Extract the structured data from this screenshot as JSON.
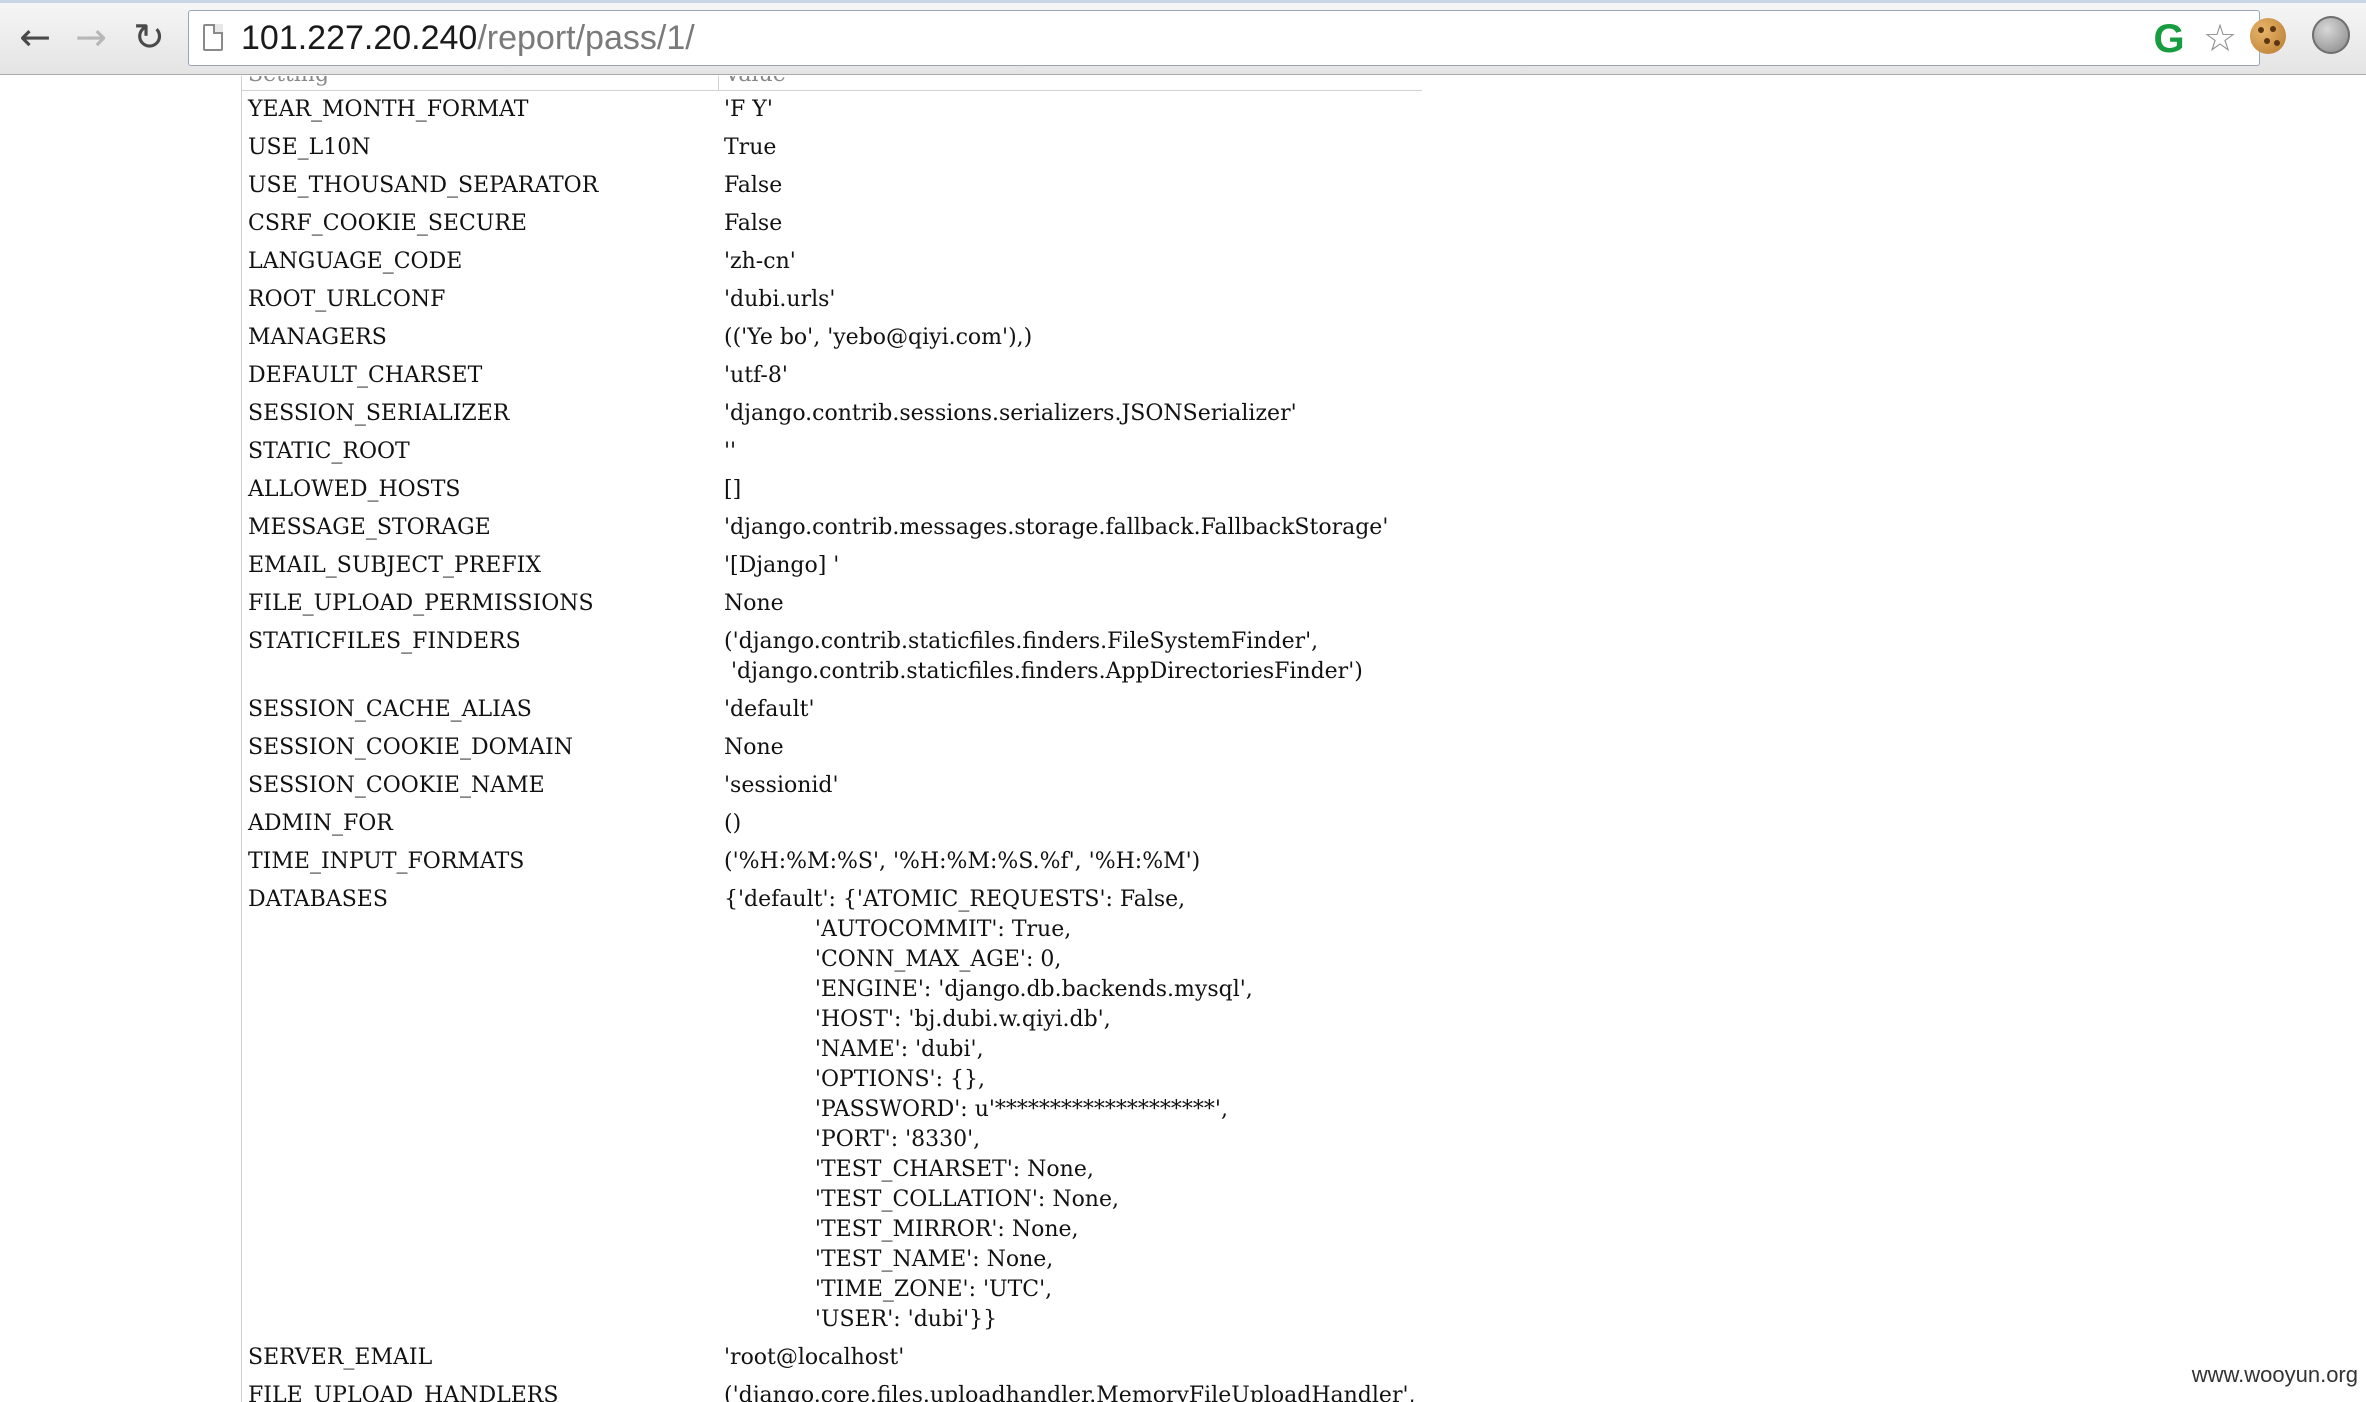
{
  "browser": {
    "url_host": "101.227.20.240",
    "url_path": "/report/pass/1/",
    "back_icon": "arrow-left-icon",
    "forward_icon": "arrow-right-icon",
    "reload_icon": "reload-icon",
    "back_glyph": "←",
    "forward_glyph": "→",
    "reload_glyph": "↻",
    "ext_glyph": "G",
    "star_glyph": "☆"
  },
  "table": {
    "header_key": "Setting",
    "header_val": "Value",
    "rows": [
      {
        "key": "YEAR_MONTH_FORMAT",
        "value": "'F Y'"
      },
      {
        "key": "USE_L10N",
        "value": "True"
      },
      {
        "key": "USE_THOUSAND_SEPARATOR",
        "value": "False"
      },
      {
        "key": "CSRF_COOKIE_SECURE",
        "value": "False"
      },
      {
        "key": "LANGUAGE_CODE",
        "value": "'zh-cn'"
      },
      {
        "key": "ROOT_URLCONF",
        "value": "'dubi.urls'"
      },
      {
        "key": "MANAGERS",
        "value": "(('Ye bo', 'yebo@qiyi.com'),)"
      },
      {
        "key": "DEFAULT_CHARSET",
        "value": "'utf-8'"
      },
      {
        "key": "SESSION_SERIALIZER",
        "value": "'django.contrib.sessions.serializers.JSONSerializer'"
      },
      {
        "key": "STATIC_ROOT",
        "value": "''"
      },
      {
        "key": "ALLOWED_HOSTS",
        "value": "[]"
      },
      {
        "key": "MESSAGE_STORAGE",
        "value": "'django.contrib.messages.storage.fallback.FallbackStorage'"
      },
      {
        "key": "EMAIL_SUBJECT_PREFIX",
        "value": "'[Django] '"
      },
      {
        "key": "FILE_UPLOAD_PERMISSIONS",
        "value": "None"
      },
      {
        "key": "STATICFILES_FINDERS",
        "value": "('django.contrib.staticfiles.finders.FileSystemFinder',\n 'django.contrib.staticfiles.finders.AppDirectoriesFinder')"
      },
      {
        "key": "SESSION_CACHE_ALIAS",
        "value": "'default'"
      },
      {
        "key": "SESSION_COOKIE_DOMAIN",
        "value": "None"
      },
      {
        "key": "SESSION_COOKIE_NAME",
        "value": "'sessionid'"
      },
      {
        "key": "ADMIN_FOR",
        "value": "()"
      },
      {
        "key": "TIME_INPUT_FORMATS",
        "value": "('%H:%M:%S', '%H:%M:%S.%f', '%H:%M')"
      },
      {
        "key": "DATABASES",
        "value": "{'default': {'ATOMIC_REQUESTS': False,\n             'AUTOCOMMIT': True,\n             'CONN_MAX_AGE': 0,\n             'ENGINE': 'django.db.backends.mysql',\n             'HOST': 'bj.dubi.w.qiyi.db',\n             'NAME': 'dubi',\n             'OPTIONS': {},\n             'PASSWORD': u'********************',\n             'PORT': '8330',\n             'TEST_CHARSET': None,\n             'TEST_COLLATION': None,\n             'TEST_MIRROR': None,\n             'TEST_NAME': None,\n             'TIME_ZONE': 'UTC',\n             'USER': 'dubi'}}"
      },
      {
        "key": "SERVER_EMAIL",
        "value": "'root@localhost'"
      },
      {
        "key": "FILE_UPLOAD_HANDLERS",
        "value": "('django.core.files.uploadhandler.MemoryFileUploadHandler',"
      }
    ]
  },
  "watermark": "www.wooyun.org"
}
